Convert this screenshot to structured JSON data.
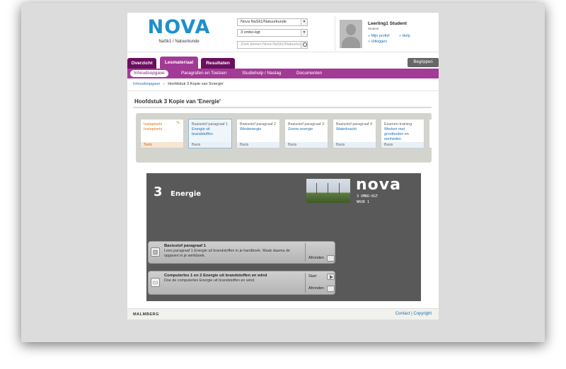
{
  "header": {
    "logo_text": "NOVA",
    "logo_subtitle": "NaSk1 / Natuurkunde",
    "method_select": "Nova NaSk1/Natuurkunde",
    "level_select": "3 vmbo-kgt",
    "search_placeholder": "Zoek binnen Nova NaSk1/Natuurkunde",
    "user_name": "Leerling1 Student",
    "user_role": "Student",
    "profile_links": [
      "» Mijn profiel",
      "» Uitloggen",
      "» Help"
    ]
  },
  "nav": {
    "tabs": [
      "Overzicht",
      "Lesmateriaal",
      "Resultaten"
    ],
    "active_tab": "Lesmateriaal",
    "begrippen_label": "Begrippen",
    "subtabs": [
      "Inhoudsopgave",
      "Paragrafen en Toetsen",
      "Studiehulp / Naslag",
      "Documenten"
    ],
    "active_subtab": "Inhoudsopgave"
  },
  "breadcrumb": {
    "root": "Inhoudsopgave",
    "separator": "›",
    "current": "Hoofdstuk 3 Kopie van 'Energie'"
  },
  "chapter_title": "Hoofdstuk 3 Kopie van 'Energie'",
  "cards": [
    {
      "sub": "Instaptoets",
      "title": "Instaptoets",
      "foot": "Toets"
    },
    {
      "sub": "Basisstof paragraaf 1",
      "title": "Energie uit brandstoffen",
      "foot": "Basis"
    },
    {
      "sub": "Basisstof paragraaf 2",
      "title": "Windenergie",
      "foot": "Basis"
    },
    {
      "sub": "Basisstof paragraaf 3",
      "title": "Zonne-energie",
      "foot": "Basis"
    },
    {
      "sub": "Basisstof paragraaf 4",
      "title": "Waterkracht",
      "foot": "Basis"
    },
    {
      "sub": "Examen-training",
      "title": "Werken met grootheden en eenheden",
      "foot": "Basis"
    }
  ],
  "banner": {
    "chapter_number": "3",
    "chapter_name": "Energie",
    "brand": "nova",
    "meta_line1": "3 VMBO-KGT",
    "meta_line2": "NASK 1"
  },
  "tasks": [
    {
      "title": "Basisstof paragraaf 1",
      "desc": "Lees paragraaf 1 Energie uit brandstoffen in je handboek. Maak daarna de opgaven in je werkboek.",
      "actions": [
        "Afronden"
      ]
    },
    {
      "title": "Computerles 1 en 2 Energie uit brandstoffen en wind",
      "desc": "Doe de computerles Energie uit brandstoffen en wind.",
      "actions": [
        "Start",
        "Afronden"
      ]
    }
  ],
  "footer": {
    "brand": "MALMBERG",
    "contact": "Contact",
    "sep": "|",
    "copyright": "Copyright"
  },
  "colors": {
    "nova_blue": "#1e8fcb",
    "nav_dark": "#6b0f5e",
    "nav_active": "#a23b95",
    "link_blue": "#1e6fb0",
    "toets_orange": "#e07b18"
  }
}
